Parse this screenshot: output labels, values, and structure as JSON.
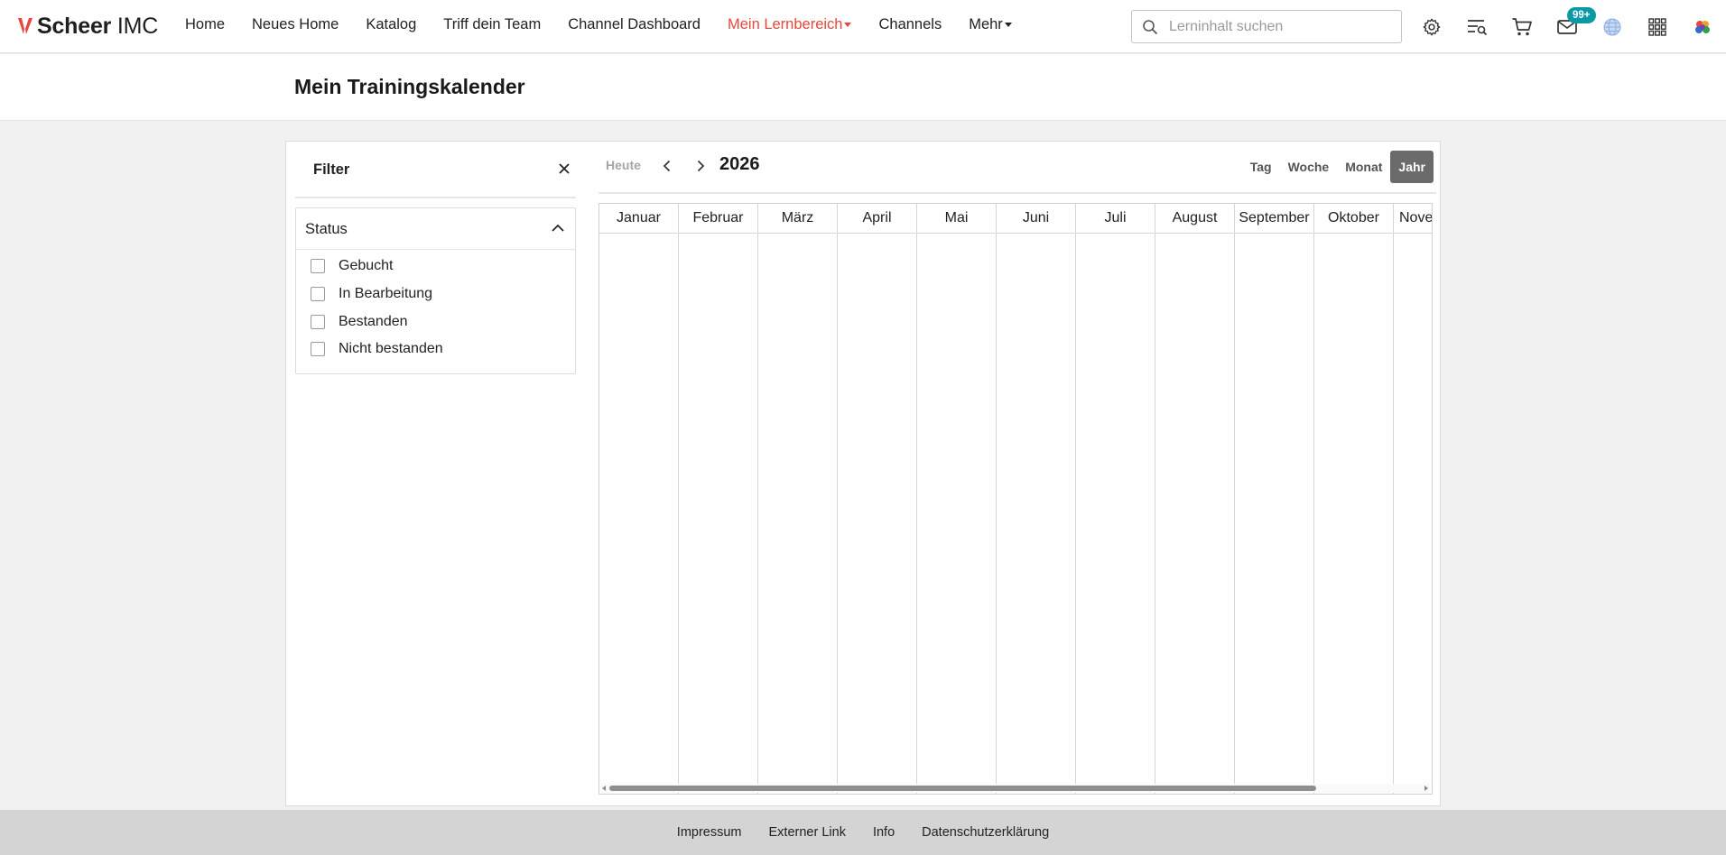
{
  "brand": {
    "name_bold": "Scheer",
    "name_light": " IMC",
    "mark_color": "#e8473b"
  },
  "nav": {
    "items": [
      {
        "label": "Home"
      },
      {
        "label": "Neues Home"
      },
      {
        "label": "Katalog"
      },
      {
        "label": "Triff dein Team"
      },
      {
        "label": "Channel Dashboard"
      },
      {
        "label": "Mein Lernbereich",
        "active": true,
        "dropdown": true
      },
      {
        "label": "Channels"
      },
      {
        "label": "Mehr",
        "dropdown": true
      }
    ],
    "active_color": "#e8473b"
  },
  "search": {
    "placeholder": "Lerninhalt suchen",
    "value": ""
  },
  "header_icons": [
    "gear-icon",
    "playlist-search-icon",
    "cart-icon",
    "mail-icon",
    "globe-icon",
    "apps-grid-icon",
    "profile-logo-icon"
  ],
  "notifications": {
    "badge": "99+",
    "badge_color": "#0a9aa6"
  },
  "page": {
    "title": "Mein Trainingskalender"
  },
  "filter": {
    "title": "Filter",
    "status": {
      "label": "Status",
      "options": [
        {
          "label": "Gebucht",
          "checked": false
        },
        {
          "label": "In Bearbeitung",
          "checked": false
        },
        {
          "label": "Bestanden",
          "checked": false
        },
        {
          "label": "Nicht bestanden",
          "checked": false
        }
      ]
    }
  },
  "calendar": {
    "today_label": "Heute",
    "year": "2026",
    "views": [
      {
        "label": "Tag"
      },
      {
        "label": "Woche"
      },
      {
        "label": "Monat"
      },
      {
        "label": "Jahr",
        "active": true
      }
    ],
    "months": [
      "Januar",
      "Februar",
      "März",
      "April",
      "Mai",
      "Juni",
      "Juli",
      "August",
      "September",
      "Oktober",
      "November"
    ],
    "visible_fraction": 0.85
  },
  "footer": {
    "links": [
      {
        "label": "Impressum"
      },
      {
        "label": "Externer Link"
      },
      {
        "label": "Info"
      },
      {
        "label": "Datenschutzerklärung"
      }
    ]
  }
}
